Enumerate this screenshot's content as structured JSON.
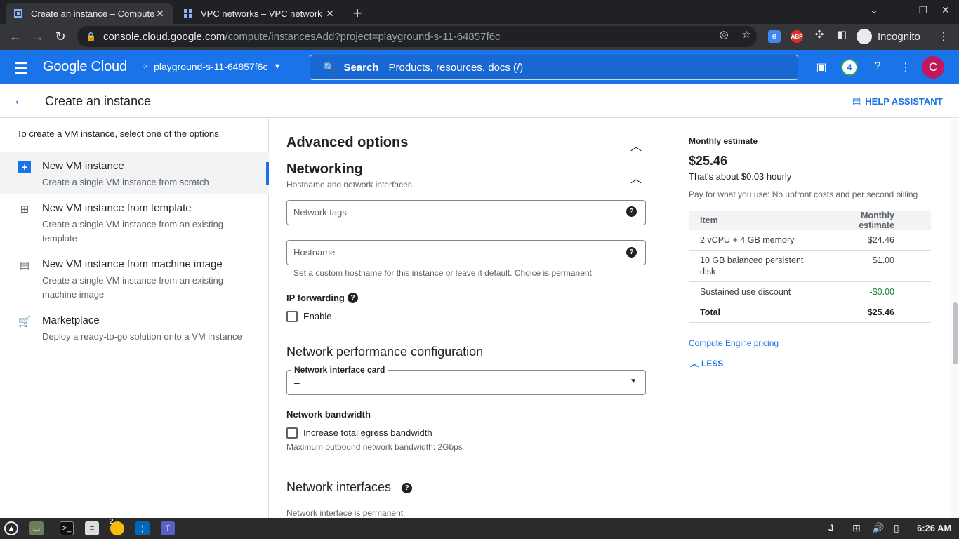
{
  "browser": {
    "tabs": [
      {
        "title": "Create an instance – Compute",
        "active": true
      },
      {
        "title": "VPC networks – VPC network",
        "active": false
      }
    ],
    "url_host": "console.cloud.google.com",
    "url_path": "/compute/instancesAdd?project=playground-s-11-64857f6c",
    "incognito_label": "Incognito",
    "ext_abp": "ABP"
  },
  "header": {
    "logo": "Google Cloud",
    "project": "playground-s-11-64857f6c",
    "search_label": "Search",
    "search_placeholder": "Products, resources, docs (/)",
    "notif_count": "4",
    "avatar_letter": "C"
  },
  "page": {
    "title": "Create an instance",
    "help_label": "HELP ASSISTANT"
  },
  "left": {
    "intro": "To create a VM instance, select one of the options:",
    "options": [
      {
        "name": "New VM instance",
        "desc": "Create a single VM instance from scratch"
      },
      {
        "name": "New VM instance from template",
        "desc": "Create a single VM instance from an existing template"
      },
      {
        "name": "New VM instance from machine image",
        "desc": "Create a single VM instance from an existing machine image"
      },
      {
        "name": "Marketplace",
        "desc": "Deploy a ready-to-go solution onto a VM instance"
      }
    ]
  },
  "form": {
    "advanced_options": "Advanced options",
    "networking": "Networking",
    "networking_sub": "Hostname and network interfaces",
    "network_tags_placeholder": "Network tags",
    "hostname_placeholder": "Hostname",
    "hostname_hint": "Set a custom hostname for this instance or leave it default. Choice is permanent",
    "ip_forwarding": "IP forwarding",
    "enable": "Enable",
    "net_perf": "Network performance configuration",
    "nic_label": "Network interface card",
    "nic_value": "–",
    "net_bandwidth": "Network bandwidth",
    "increase_egress": "Increase total egress bandwidth",
    "max_outbound": "Maximum outbound network bandwidth: 2Gbps",
    "net_interfaces": "Network interfaces",
    "net_interface_perm": "Network interface is permanent"
  },
  "estimate": {
    "heading": "Monthly estimate",
    "price": "$25.46",
    "hourly": "That's about $0.03 hourly",
    "billing_note": "Pay for what you use: No upfront costs and per second billing",
    "col_item": "Item",
    "col_estimate": "Monthly estimate",
    "rows": [
      {
        "item": "2 vCPU + 4 GB memory",
        "cost": "$24.46"
      },
      {
        "item": "10 GB balanced persistent disk",
        "cost": "$1.00"
      },
      {
        "item": "Sustained use discount",
        "cost": "-$0.00"
      }
    ],
    "total_label": "Total",
    "total_value": "$25.46",
    "pricing_link": "Compute Engine pricing",
    "less": "LESS"
  },
  "taskbar": {
    "chrome_badge": "2",
    "time": "6:26 AM"
  }
}
